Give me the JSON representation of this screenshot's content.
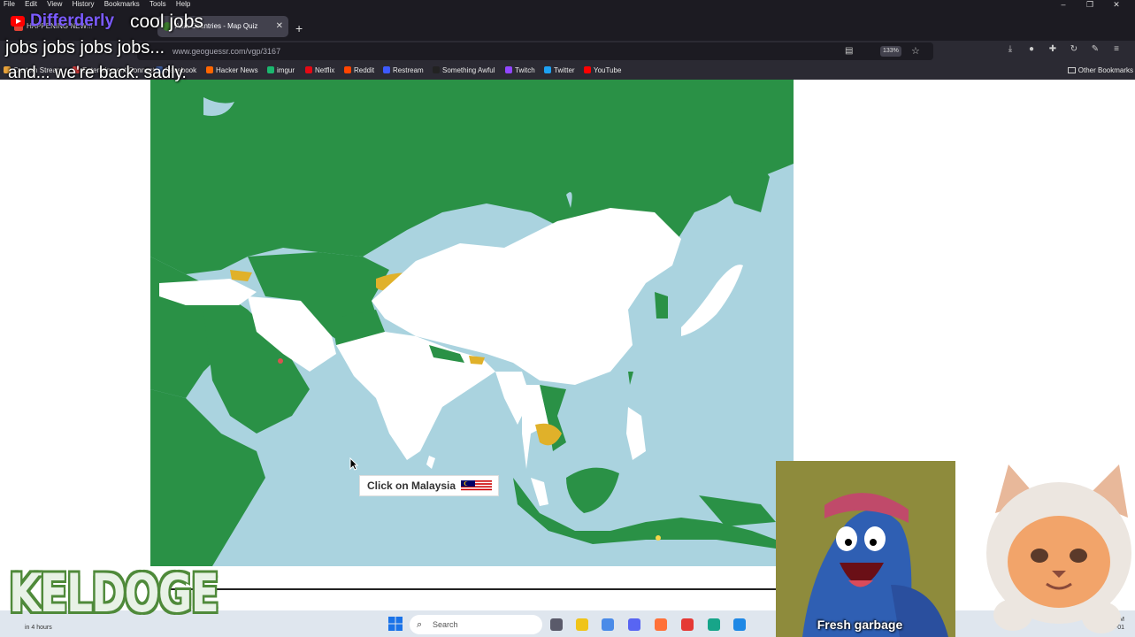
{
  "menubar": {
    "items": [
      "File",
      "Edit",
      "View",
      "History",
      "Bookmarks",
      "Tools",
      "Help"
    ]
  },
  "tabs": {
    "inactive_label": "HAPPENING NEW!!!",
    "active_label": "Asia Countries - Map Quiz"
  },
  "navbar": {
    "url": "www.geoguessr.com/vgp/3167",
    "zoom": "133%"
  },
  "bookmarks": [
    {
      "label": "Custom Stream",
      "color": "#e8a23a"
    },
    {
      "label": "Entertainment Connect",
      "color": "#d23b3b"
    },
    {
      "label": "Facebook",
      "color": "#3b5998"
    },
    {
      "label": "Hacker News",
      "color": "#ff6600"
    },
    {
      "label": "imgur",
      "color": "#1bb76e"
    },
    {
      "label": "Netflix",
      "color": "#e50914"
    },
    {
      "label": "Reddit",
      "color": "#ff4500"
    },
    {
      "label": "Restream",
      "color": "#3d5afe"
    },
    {
      "label": "Something Awful",
      "color": "#222222"
    },
    {
      "label": "Twitch",
      "color": "#9146ff"
    },
    {
      "label": "Twitter",
      "color": "#1da1f2"
    },
    {
      "label": "YouTube",
      "color": "#ff0000"
    }
  ],
  "other_bookmarks": "Other Bookmarks",
  "quiz": {
    "prompt": "Click on Malaysia",
    "colors": {
      "water": "#aad3df",
      "done": "#2a9146",
      "missed": "#e0b12a",
      "todo": "#ffffff",
      "wrong": "#d9534f"
    }
  },
  "taskbar": {
    "weather": "in 4 hours",
    "search_placeholder": "Search",
    "clock_time": "AM",
    "clock_date": "25-11-01"
  },
  "stream": {
    "chat_name": "Differderly",
    "chat_message": "cool jobs",
    "line2": "jobs jobs jobs jobs...",
    "line3": "and... we're back. sadly.",
    "logo": "KELDOGE",
    "cam_caption": "Fresh garbage"
  }
}
